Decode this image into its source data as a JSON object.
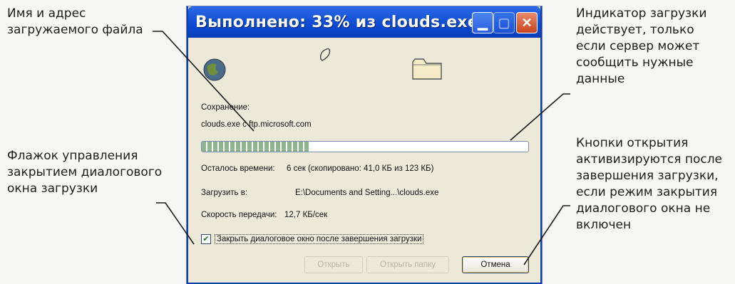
{
  "callouts": {
    "file": "Имя и адрес\nзагружаемого файла",
    "checkbox": "Флажок управления\nзакрытием диалогового\nокна загрузки",
    "progress": "Индикатор загрузки\nдействует, только\nесли сервер может\nсообщить нужные\nданные",
    "buttons": "Кнопки открытия\nактивизируются после\nзавершения загрузки,\nесли режим закрытия\nдиалогового окна не\nвключен"
  },
  "dialog": {
    "title": "Выполнено: 33% из clouds.exe",
    "save_label": "Сохранение:",
    "save_value": "clouds.exe с ftp.microsoft.com",
    "progress_fraction": 0.33,
    "time_left_label": "Осталось времени:",
    "time_left_value": "6 сек (скопировано: 41,0 КБ из 123 КБ)",
    "download_to_label": "Загрузить в:",
    "download_to_value": "E:\\Documents and Setting...\\clouds.exe",
    "speed_label": "Скорость передачи:",
    "speed_value": "12,7 КБ/сек",
    "close_checkbox_label": "Закрыть диалоговое окно после завершения загрузки",
    "close_checkbox_checked": true,
    "open_button": "Открыть",
    "open_folder_button": "Открыть папку",
    "cancel_button": "Отмена"
  },
  "icons": {
    "titlebar": [
      "minimize-icon",
      "maximize-icon",
      "close-icon"
    ],
    "animation": [
      "globe-icon",
      "paper-icon",
      "folder-icon"
    ]
  },
  "colors": {
    "titlebar": "#0b4ad2",
    "dialog_bg": "#ece9d8",
    "progress_fill": "#8bb48f"
  }
}
